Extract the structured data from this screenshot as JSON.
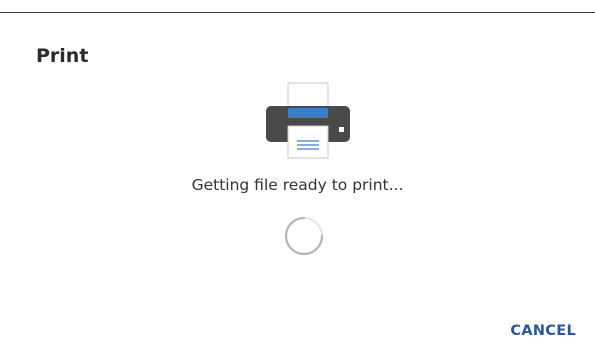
{
  "dialog": {
    "title": "Print",
    "status_text": "Getting file ready to print...",
    "cancel_label": "CANCEL",
    "icons": {
      "printer": "printer-icon",
      "spinner": "loading-spinner-icon"
    },
    "colors": {
      "accent": "#2b5797",
      "printer_body": "#4a4a4a",
      "paper_tray": "#3d7cc9"
    }
  }
}
